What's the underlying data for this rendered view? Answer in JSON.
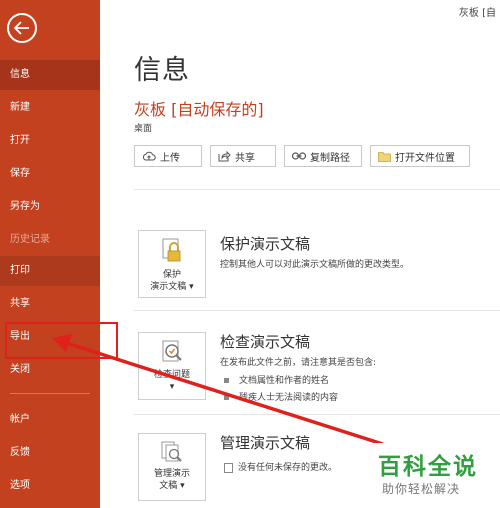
{
  "window": {
    "corner_title": "灰板 [自"
  },
  "sidebar": {
    "items": [
      {
        "label": "信息"
      },
      {
        "label": "新建"
      },
      {
        "label": "打开"
      },
      {
        "label": "保存"
      },
      {
        "label": "另存为"
      },
      {
        "label": "历史记录"
      },
      {
        "label": "打印"
      },
      {
        "label": "共享"
      },
      {
        "label": "导出"
      },
      {
        "label": "关闭"
      },
      {
        "label": "帐户"
      },
      {
        "label": "反馈"
      },
      {
        "label": "选项"
      }
    ],
    "active": "信息",
    "disabled": "历史记录"
  },
  "main": {
    "title": "信息",
    "doc_name": "灰板 [自动保存的]",
    "doc_location": "桌面",
    "actions": [
      {
        "label": "上传",
        "icon": "cloud-upload-icon"
      },
      {
        "label": "共享",
        "icon": "share-icon"
      },
      {
        "label": "复制路径",
        "icon": "link-icon"
      },
      {
        "label": "打开文件位置",
        "icon": "folder-icon"
      }
    ],
    "sections": [
      {
        "tile_label_1": "保护",
        "tile_label_2": "演示文稿 ▾",
        "icon": "lock-icon",
        "title": "保护演示文稿",
        "desc": "控制其他人可以对此演示文稿所做的更改类型。"
      },
      {
        "tile_label_1": "检查问题",
        "tile_label_2": "▾",
        "icon": "inspect-icon",
        "title": "检查演示文稿",
        "desc": "在发布此文件之前，请注意其是否包含:",
        "bullets": [
          "文档属性和作者的姓名",
          "残疾人士无法阅读的内容"
        ]
      },
      {
        "tile_label_1": "管理演示",
        "tile_label_2": "文稿",
        "tile_label_3": "文稿 ▾",
        "icon": "manage-doc-icon",
        "title": "管理演示文稿",
        "desc": "没有任何未保存的更改。"
      }
    ]
  },
  "watermark": {
    "main": "百科全说",
    "sub": "助你轻松解决"
  },
  "colors": {
    "sidebar": "#c3411f",
    "accent_text": "#c3411f",
    "annotation": "#e0201a",
    "watermark": "#2f9f3f"
  }
}
